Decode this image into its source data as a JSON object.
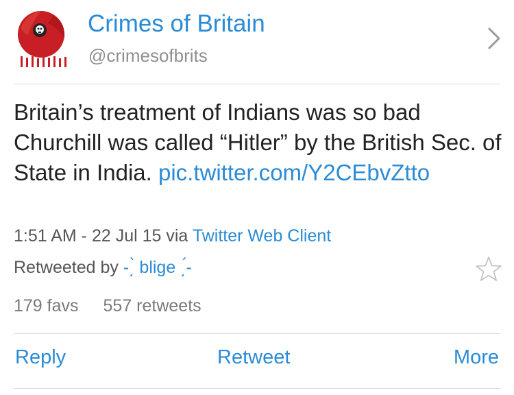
{
  "profile": {
    "display_name": "Crimes of Britain",
    "handle": "@crimesofbrits",
    "avatar_icon": "poppy-skull-icon"
  },
  "tweet": {
    "text": "Britain’s treatment of Indians was so bad Churchill was called “Hitler” by the British Sec. of State in India. ",
    "link_text": "pic.twitter.com/Y2CEbvZtto",
    "time": "1:51 AM - 22 Jul 15",
    "via_label": "via",
    "client": "Twitter Web Client"
  },
  "retweet": {
    "label": "Retweeted by",
    "user": "-͵̀ blige ͵́-"
  },
  "counts": {
    "favs": "179 favs",
    "retweets": "557 retweets"
  },
  "actions": {
    "reply": "Reply",
    "retweet": "Retweet",
    "more": "More"
  },
  "icons": {
    "chevron": "chevron-right-icon",
    "star": "star-outline-icon"
  },
  "colors": {
    "link_blue": "#2a8bd6",
    "poppy_red": "#c81e25"
  }
}
